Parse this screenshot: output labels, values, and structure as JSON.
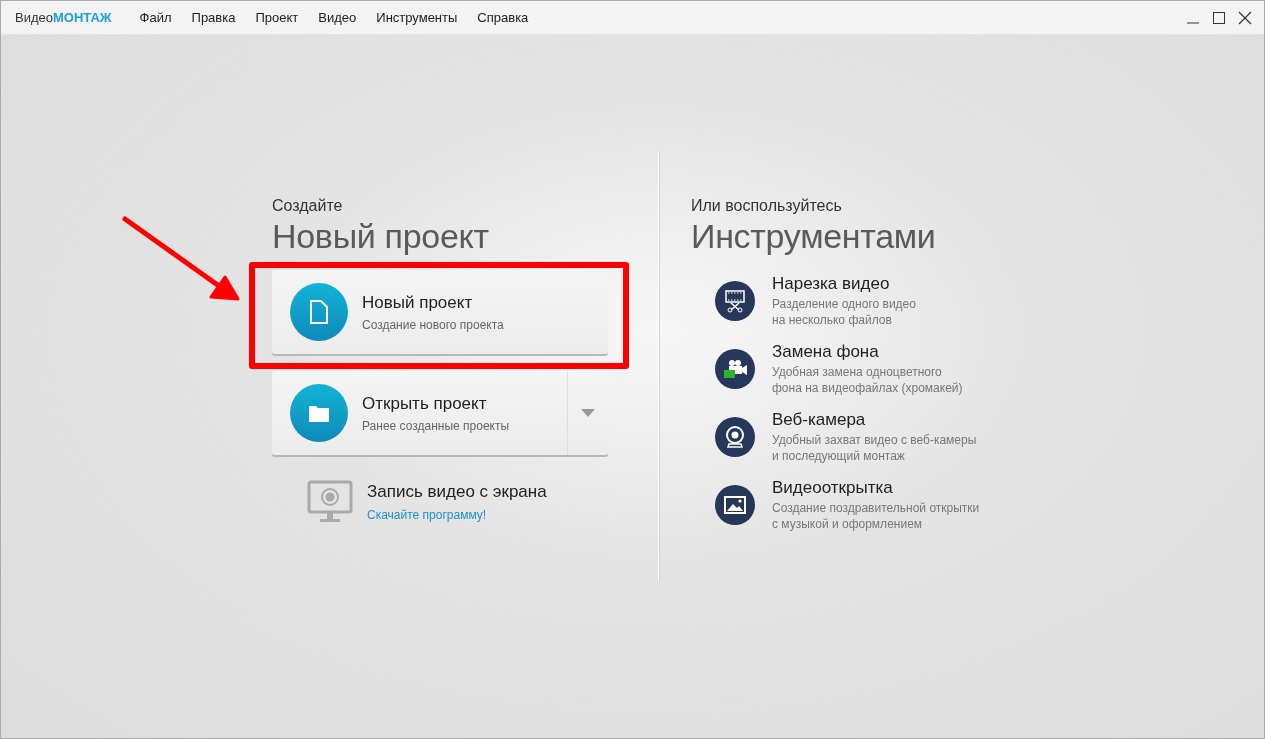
{
  "window": {
    "app_name_prefix": "Видео",
    "app_name_accent": "МОНТАЖ"
  },
  "menu": [
    "Файл",
    "Правка",
    "Проект",
    "Видео",
    "Инструменты",
    "Справка"
  ],
  "create": {
    "eyebrow": "Создайте",
    "heading": "Новый проект",
    "actions": [
      {
        "kind": "new",
        "title": "Новый проект",
        "subtitle": "Создание нового проекта",
        "has_dropdown": false,
        "highlighted": true
      },
      {
        "kind": "open",
        "title": "Открыть проект",
        "subtitle": "Ранее созданные проекты",
        "has_dropdown": true,
        "highlighted": false
      }
    ],
    "screen_recording": {
      "title": "Запись видео с экрана",
      "link": "Скачайте программу!"
    }
  },
  "tools": {
    "eyebrow": "Или воспользуйтесь",
    "heading": "Инструментами",
    "items": [
      {
        "kind": "cut",
        "title": "Нарезка видео",
        "description": "Разделение одного видео\nна несколько файлов"
      },
      {
        "kind": "chroma",
        "title": "Замена фона",
        "description": "Удобная замена одноцветного\nфона на видеофайлах (хромакей)"
      },
      {
        "kind": "webcam",
        "title": "Веб-камера",
        "description": "Удобный захват видео с веб-камеры\nи последующий монтаж"
      },
      {
        "kind": "postcard",
        "title": "Видеооткрытка",
        "description": "Создание поздравительной открытки\nс музыкой и оформлением"
      }
    ]
  }
}
